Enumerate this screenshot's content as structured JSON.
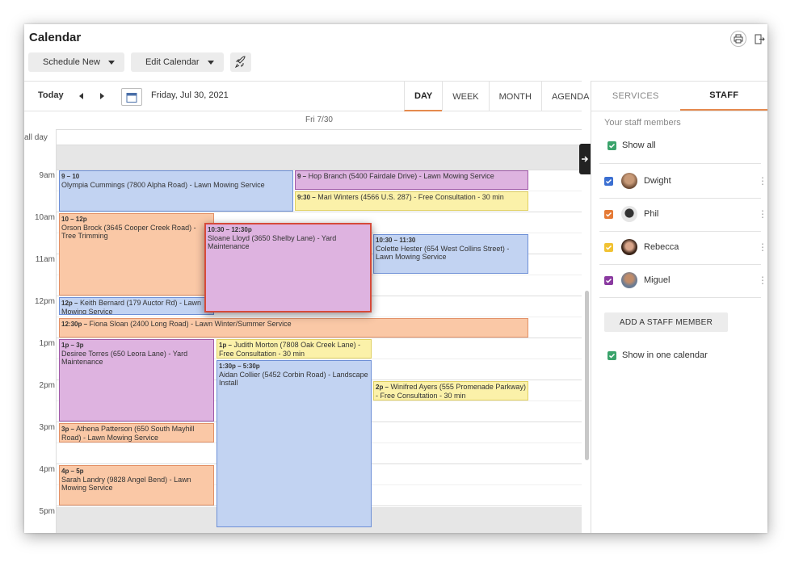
{
  "app": {
    "title": "Calendar"
  },
  "toolbar": {
    "schedule_new": "Schedule New",
    "edit_calendar": "Edit Calendar"
  },
  "nav": {
    "today": "Today",
    "date": "Friday, Jul 30, 2021"
  },
  "views": [
    "DAY",
    "WEEK",
    "MONTH",
    "AGENDA"
  ],
  "active_view": "DAY",
  "calendar": {
    "day_header": "Fri 7/30",
    "all_day_label": "all day",
    "hours": [
      "9am",
      "10am",
      "11am",
      "12pm",
      "1pm",
      "2pm",
      "3pm",
      "4pm",
      "5pm"
    ],
    "events": [
      {
        "time": "9 – 10",
        "text": "Olympia Cummings (7800 Alpha Road) - Lawn Mowing Service",
        "color": "blue"
      },
      {
        "time": "9 –",
        "text": "Hop Branch (5400 Fairdale Drive) - Lawn Mowing Service",
        "color": "purple"
      },
      {
        "time": "9:30 –",
        "text": "Mari Winters (4566 U.S. 287) - Free Consultation - 30 min",
        "color": "yellow"
      },
      {
        "time": "10 – 12p",
        "text": "Orson Brock (3645 Cooper Creek Road) - Tree Trimming",
        "color": "orange"
      },
      {
        "time": "10:30 – 12:30p",
        "text": "Sloane Lloyd (3650 Shelby Lane) - Yard Maintenance",
        "color": "purple"
      },
      {
        "time": "10:30 – 11:30",
        "text": "Colette Hester (654 West Collins Street) - Lawn Mowing Service",
        "color": "blue"
      },
      {
        "time": "12p –",
        "text": "Keith Bernard (179 Auctor Rd) - Lawn Mowing Service",
        "color": "blue"
      },
      {
        "time": "12:30p –",
        "text": "Fiona Sloan (2400 Long Road) - Lawn Winter/Summer Service",
        "color": "orange"
      },
      {
        "time": "1p – 3p",
        "text": "Desiree Torres (650 Leora Lane) - Yard Maintenance",
        "color": "purple"
      },
      {
        "time": "1p –",
        "text": "Judith Morton (7808 Oak Creek Lane) - Free Consultation - 30 min",
        "color": "yellow"
      },
      {
        "time": "1:30p – 5:30p",
        "text": "Aidan Collier (5452 Corbin Road) - Landscape Install",
        "color": "blue"
      },
      {
        "time": "2p –",
        "text": "Winifred Ayers (555 Promenade Parkway) - Free Consultation - 30 min",
        "color": "yellow"
      },
      {
        "time": "3p –",
        "text": "Athena Patterson (650 South Mayhill Road) - Lawn Mowing Service",
        "color": "orange"
      },
      {
        "time": "4p – 5p",
        "text": "Sarah Landry (9828 Angel Bend) - Lawn Mowing Service",
        "color": "orange"
      }
    ]
  },
  "panel": {
    "tabs": [
      "SERVICES",
      "STAFF"
    ],
    "active_tab": "STAFF",
    "heading": "Your staff members",
    "show_all": "Show all",
    "staff": [
      {
        "name": "Dwight",
        "color": "#3b6fd1"
      },
      {
        "name": "Phil",
        "color": "#e57a35"
      },
      {
        "name": "Rebecca",
        "color": "#f1c232"
      },
      {
        "name": "Miguel",
        "color": "#8a3aa0"
      }
    ],
    "add_staff": "ADD A STAFF MEMBER",
    "show_in_one": "Show in one calendar"
  },
  "colors": {
    "accent": "#e58a4e",
    "checkbox_green": "#3aa36b"
  }
}
